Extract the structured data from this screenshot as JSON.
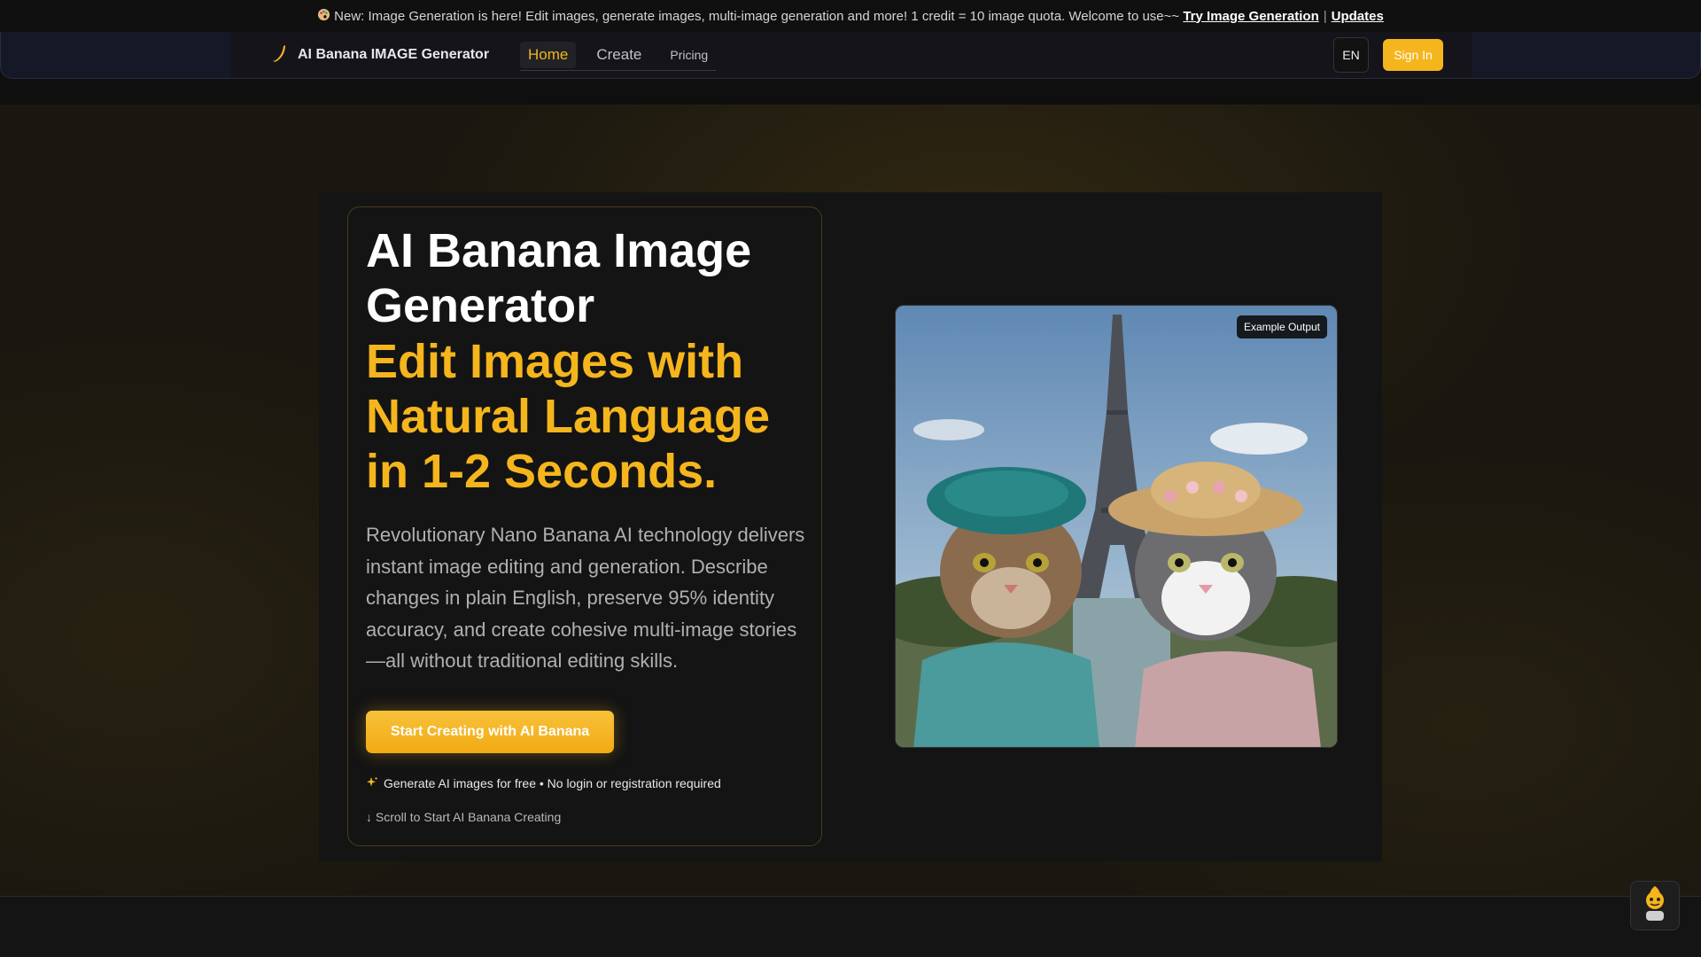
{
  "announcement": {
    "icon": "palette-icon",
    "text": "New: Image Generation is here! Edit images, generate images, multi-image generation and more! 1 credit = 10 image quota. Welcome to use~~",
    "link_try": "Try Image Generation",
    "separator": "|",
    "link_updates": "Updates"
  },
  "nav": {
    "brand": "AI Banana IMAGE Generator",
    "tabs": [
      {
        "label": "Home",
        "active": true
      },
      {
        "label": "Create",
        "active": false
      },
      {
        "label": "Pricing",
        "active": false
      }
    ],
    "lang": "EN",
    "signin": "Sign In"
  },
  "hero": {
    "title": "AI Banana Image Generator",
    "subtitle": "Edit Images with Natural Language in 1-2 Seconds.",
    "description": "Revolutionary Nano Banana AI technology delivers instant image editing and generation. Describe changes in plain English, preserve 95% identity accuracy, and create cohesive multi-image stories—all without traditional editing skills.",
    "cta": "Start Creating with AI Banana",
    "free_note": "Generate AI images for free • No login or registration required",
    "scroll_note": "↓ Scroll to Start AI Banana Creating",
    "example_badge": "Example Output"
  },
  "colors": {
    "accent": "#f5b51c",
    "background": "#141414",
    "nav_background": "#151826"
  }
}
